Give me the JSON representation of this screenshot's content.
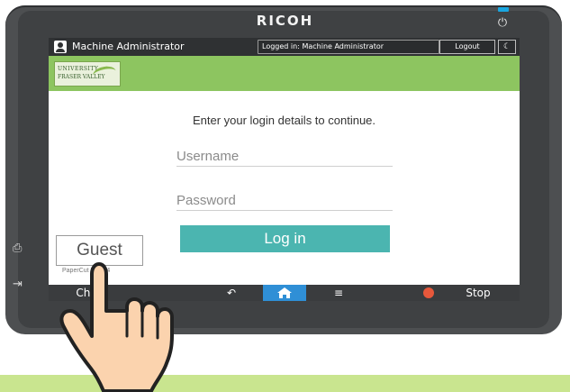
{
  "brand": "RICOH",
  "topbar": {
    "user_label": "Machine Administrator",
    "login_status": "Logged in: Machine Administrator",
    "logout_label": "Logout"
  },
  "logo": {
    "line1": "UNIVERSITY",
    "line2": "FRASER VALLEY"
  },
  "login": {
    "prompt": "Enter your login details to continue.",
    "username_placeholder": "Username",
    "password_placeholder": "Password",
    "login_label": "Log in",
    "guest_label": "Guest",
    "papercut_label": "PaperCut MF 1.4"
  },
  "bottombar": {
    "left_label": "Che",
    "stop_label": "Stop"
  },
  "colors": {
    "accent_green": "#8dc560",
    "login_teal": "#4bb5b0",
    "home_blue": "#2f8fd6",
    "stop_red": "#e7583b"
  }
}
